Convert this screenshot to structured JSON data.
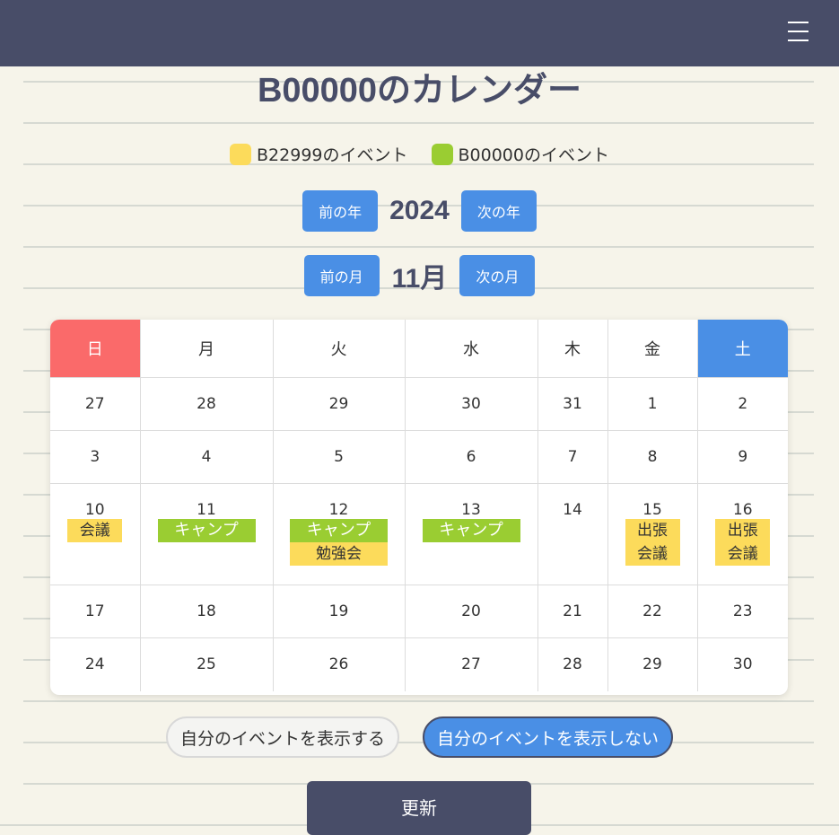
{
  "header": {
    "menu_icon": "hamburger-menu-icon"
  },
  "title": "B00000のカレンダー",
  "legend": [
    {
      "label": "B22999のイベント",
      "color": "#fcdb5b"
    },
    {
      "label": "B00000のイベント",
      "color": "#9acd32"
    }
  ],
  "year_nav": {
    "prev_label": "前の年",
    "value": "2024",
    "next_label": "次の年"
  },
  "month_nav": {
    "prev_label": "前の月",
    "value": "11月",
    "next_label": "次の月"
  },
  "calendar": {
    "weekdays": [
      "日",
      "月",
      "火",
      "水",
      "木",
      "金",
      "土"
    ],
    "weeks": [
      [
        {
          "day": "27",
          "events": []
        },
        {
          "day": "28",
          "events": []
        },
        {
          "day": "29",
          "events": []
        },
        {
          "day": "30",
          "events": []
        },
        {
          "day": "31",
          "events": []
        },
        {
          "day": "1",
          "events": []
        },
        {
          "day": "2",
          "events": []
        }
      ],
      [
        {
          "day": "3",
          "events": []
        },
        {
          "day": "4",
          "events": []
        },
        {
          "day": "5",
          "events": []
        },
        {
          "day": "6",
          "events": []
        },
        {
          "day": "7",
          "events": []
        },
        {
          "day": "8",
          "events": []
        },
        {
          "day": "9",
          "events": []
        }
      ],
      [
        {
          "day": "10",
          "events": [
            {
              "label": "会議",
              "owner": "B22999"
            }
          ]
        },
        {
          "day": "11",
          "events": [
            {
              "label": "キャンプ",
              "owner": "B00000"
            }
          ]
        },
        {
          "day": "12",
          "events": [
            {
              "label": "キャンプ",
              "owner": "B00000"
            },
            {
              "label": "勉強会",
              "owner": "B22999"
            }
          ]
        },
        {
          "day": "13",
          "events": [
            {
              "label": "キャンプ",
              "owner": "B00000"
            }
          ]
        },
        {
          "day": "14",
          "events": []
        },
        {
          "day": "15",
          "events": [
            {
              "label": "出張",
              "owner": "B22999"
            },
            {
              "label": "会議",
              "owner": "B22999"
            }
          ]
        },
        {
          "day": "16",
          "events": [
            {
              "label": "出張",
              "owner": "B22999"
            },
            {
              "label": "会議",
              "owner": "B22999"
            }
          ]
        }
      ],
      [
        {
          "day": "17",
          "events": []
        },
        {
          "day": "18",
          "events": []
        },
        {
          "day": "19",
          "events": []
        },
        {
          "day": "20",
          "events": []
        },
        {
          "day": "21",
          "events": []
        },
        {
          "day": "22",
          "events": []
        },
        {
          "day": "23",
          "events": []
        }
      ],
      [
        {
          "day": "24",
          "events": []
        },
        {
          "day": "25",
          "events": []
        },
        {
          "day": "26",
          "events": []
        },
        {
          "day": "27",
          "events": []
        },
        {
          "day": "28",
          "events": []
        },
        {
          "day": "29",
          "events": []
        },
        {
          "day": "30",
          "events": []
        }
      ]
    ]
  },
  "toggles": {
    "show_label": "自分のイベントを表示する",
    "hide_label": "自分のイベントを表示しない",
    "selected": "hide"
  },
  "update_label": "更新",
  "colors": {
    "header_bg": "#484d68",
    "accent_blue": "#4a8fe5",
    "sunday_red": "#fa6a6a",
    "event_yellow": "#fcdb5b",
    "event_green": "#9acd32"
  }
}
